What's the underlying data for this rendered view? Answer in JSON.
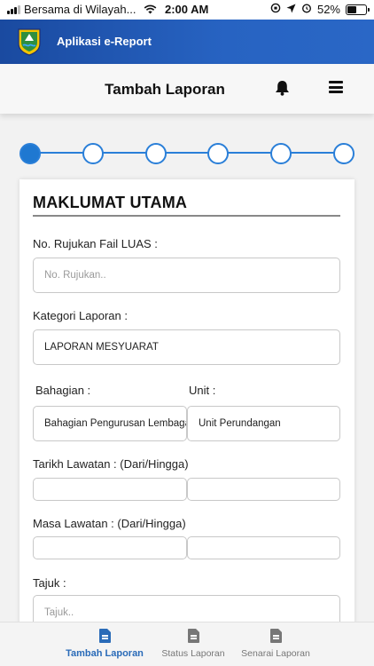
{
  "status_bar": {
    "carrier": "Bersama di Wilayah...",
    "time": "2:00 AM",
    "battery": "52%",
    "battery_level": 0.52
  },
  "app_bar": {
    "title": "Aplikasi e-Report"
  },
  "header": {
    "title": "Tambah Laporan"
  },
  "stepper": {
    "total_steps": 6,
    "current_step": 1
  },
  "form": {
    "section_title": "MAKLUMAT UTAMA",
    "ref_no": {
      "label": "No. Rujukan Fail LUAS :",
      "placeholder": "No. Rujukan..",
      "value": ""
    },
    "category": {
      "label": "Kategori Laporan :",
      "value": "LAPORAN MESYUARAT"
    },
    "division": {
      "label": "Bahagian :",
      "value": "Bahagian Pengurusan Lembaga"
    },
    "unit": {
      "label": "Unit :",
      "value": "Unit Perundangan"
    },
    "visit_date": {
      "label": "Tarikh Lawatan : (Dari/Hingga)",
      "from": "",
      "to": ""
    },
    "visit_time": {
      "label": "Masa Lawatan : (Dari/Hingga)",
      "from": "",
      "to": ""
    },
    "title": {
      "label": "Tajuk :",
      "placeholder": "Tajuk..",
      "value": ""
    }
  },
  "tabs": [
    {
      "label": "Tambah Laporan",
      "icon": "document-icon",
      "active": true
    },
    {
      "label": "Status Laporan",
      "icon": "document-icon",
      "active": false
    },
    {
      "label": "Senarai Laporan",
      "icon": "document-icon",
      "active": false
    }
  ],
  "colors": {
    "app_bar": "#2763c2",
    "accent": "#1f78d1",
    "active_tab": "#2a6bb8",
    "inactive_tab": "#777777"
  }
}
